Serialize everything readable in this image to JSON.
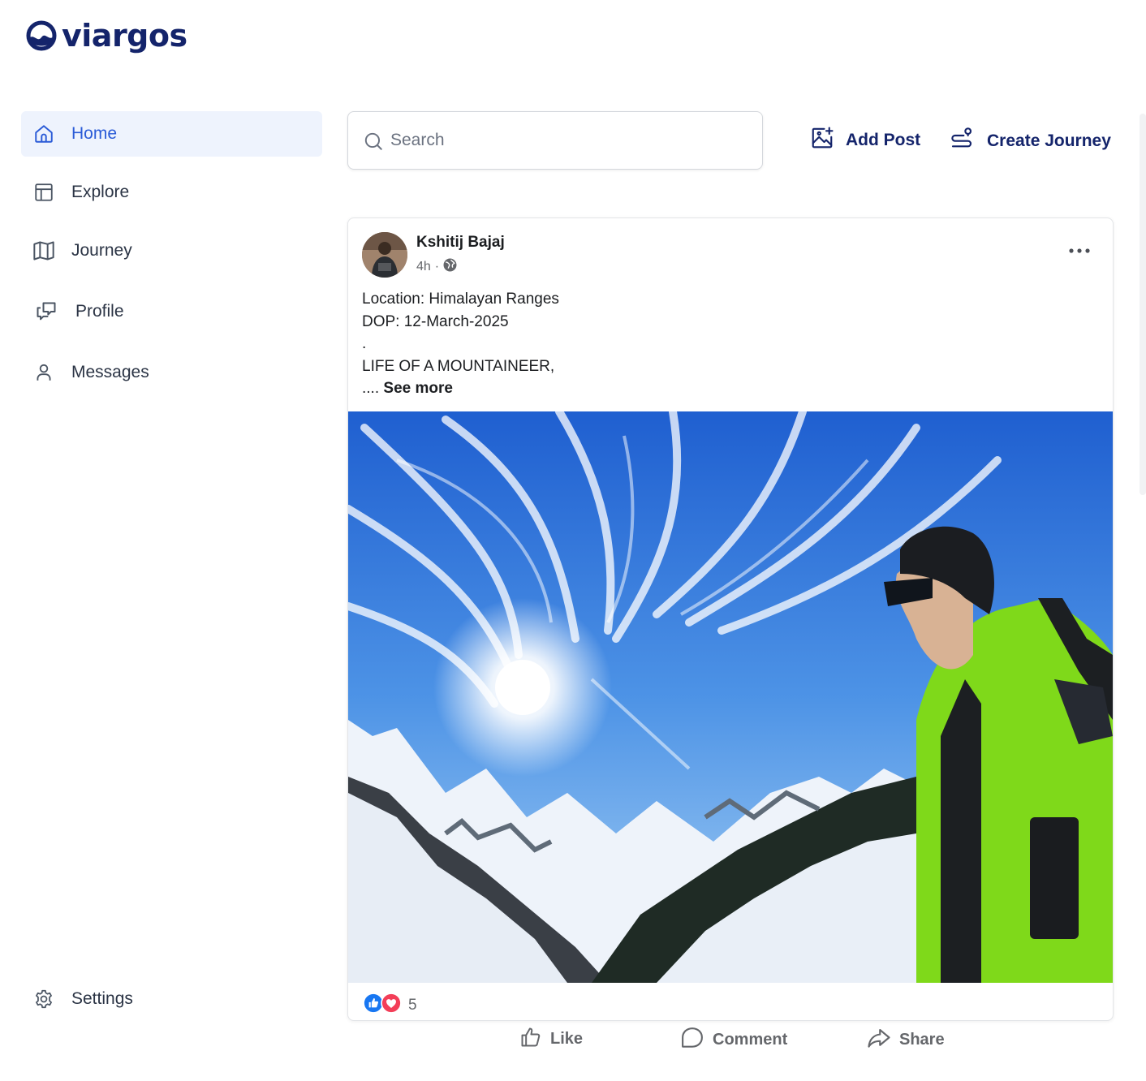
{
  "brand": {
    "name": "viargos"
  },
  "sidebar": {
    "items": [
      {
        "label": "Home",
        "icon": "home-icon",
        "active": true
      },
      {
        "label": "Explore",
        "icon": "layout-icon",
        "active": false
      },
      {
        "label": "Journey",
        "icon": "map-icon",
        "active": false
      },
      {
        "label": "Profile",
        "icon": "chat-icon",
        "active": false
      },
      {
        "label": "Messages",
        "icon": "user-icon",
        "active": false
      }
    ],
    "settings": {
      "label": "Settings",
      "icon": "gear-icon"
    }
  },
  "search": {
    "placeholder": "Search",
    "value": ""
  },
  "header_actions": {
    "add_post": {
      "label": "Add Post",
      "icon": "image-plus-icon"
    },
    "create_journey": {
      "label": "Create Journey",
      "icon": "route-icon"
    }
  },
  "post": {
    "author": "Kshitij Bajaj",
    "time": "4h",
    "separator": "·",
    "visibility_icon": "globe-icon",
    "lines": [
      "Location: Himalayan Ranges",
      "DOP: 12-March-2025",
      ".",
      "LIFE OF A MOUNTAINEER,"
    ],
    "ellipsis": ".... ",
    "see_more": "See more",
    "reaction_count": "5",
    "actions": {
      "like": "Like",
      "comment": "Comment",
      "share": "Share"
    }
  },
  "colors": {
    "brand": "#14246b",
    "accent": "#2a5bd7",
    "active_bg": "#eef3fd",
    "like_blue": "#1877f2",
    "love_red": "#f33e58"
  }
}
